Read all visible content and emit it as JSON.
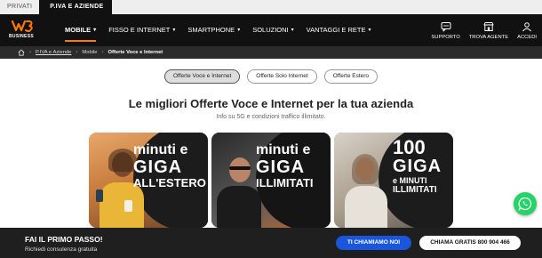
{
  "segments": {
    "private_label": "PRIVATI",
    "business_label": "P.IVA E AZIENDE"
  },
  "brand": {
    "logo_sub": "BUSINESS",
    "accent": "#ff7900"
  },
  "nav": {
    "items": [
      {
        "label": "MOBILE"
      },
      {
        "label": "FISSO E INTERNET"
      },
      {
        "label": "SMARTPHONE"
      },
      {
        "label": "SOLUZIONI"
      },
      {
        "label": "VANTAGGI E RETE"
      }
    ],
    "utilities": [
      {
        "label": "SUPPORTO",
        "icon": "support-icon"
      },
      {
        "label": "TROVA AGENTE",
        "icon": "store-icon"
      },
      {
        "label": "ACCEDI",
        "icon": "user-icon"
      }
    ]
  },
  "breadcrumb": {
    "home_icon": "home-icon",
    "items": [
      "P.IVA e Aziende",
      "Mobile",
      "Offerte Voce e Internet"
    ]
  },
  "filters": {
    "options": [
      "Offerte Voce e Internet",
      "Offerte Solo Internet",
      "Offerte Estero"
    ],
    "selected": "Offerte Voce e Internet"
  },
  "hero": {
    "title": "Le migliori Offerte Voce e Internet per la tua azienda",
    "subtitle": "Info su 5G e condizioni traffico illimitato."
  },
  "cards": [
    {
      "line1": "minuti e",
      "line2": "GIGA",
      "line3": "ALL'ESTERO"
    },
    {
      "line1": "minuti e",
      "line2": "GIGA",
      "line3": "ILLIMITATI"
    },
    {
      "line1": "100",
      "line2": "GIGA",
      "line3": "e MINUTI",
      "line4": "ILLIMITATI"
    }
  ],
  "cta": {
    "title": "FAI IL PRIMO PASSO!",
    "subtitle": "Richiedi consulenza gratuita",
    "call_button": "TI CHIAMIAMO NOI",
    "free_button": "CHIAMA GRATIS 800 904 466",
    "call_color": "#1a56db"
  },
  "chat": {
    "icon": "whatsapp-icon",
    "color": "#25d366"
  }
}
